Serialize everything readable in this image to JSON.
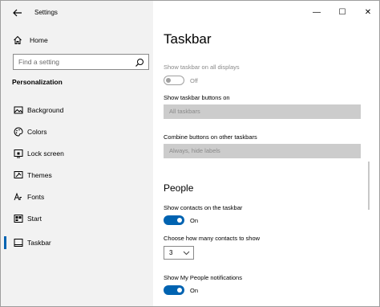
{
  "window": {
    "app_title": "Settings",
    "controls": {
      "minimize": "—",
      "maximize": "☐",
      "close": "✕"
    }
  },
  "sidebar": {
    "home_label": "Home",
    "search_placeholder": "Find a setting",
    "section_label": "Personalization",
    "items": [
      {
        "label": "Background",
        "icon": "picture-icon"
      },
      {
        "label": "Colors",
        "icon": "palette-icon"
      },
      {
        "label": "Lock screen",
        "icon": "lock-screen-icon"
      },
      {
        "label": "Themes",
        "icon": "brush-icon"
      },
      {
        "label": "Fonts",
        "icon": "font-icon"
      },
      {
        "label": "Start",
        "icon": "start-icon"
      },
      {
        "label": "Taskbar",
        "icon": "taskbar-icon",
        "active": true
      }
    ]
  },
  "main": {
    "title": "Taskbar",
    "show_all_displays": {
      "label": "Show taskbar on all displays",
      "state": "Off"
    },
    "show_buttons_on": {
      "label": "Show taskbar buttons on",
      "value": "All taskbars"
    },
    "combine_buttons": {
      "label": "Combine buttons on other taskbars",
      "value": "Always, hide labels"
    },
    "people": {
      "heading": "People",
      "show_contacts": {
        "label": "Show contacts on the taskbar",
        "state": "On"
      },
      "contacts_count": {
        "label": "Choose how many contacts to show",
        "value": "3"
      },
      "notifications": {
        "label": "Show My People notifications",
        "state": "On"
      }
    }
  },
  "colors": {
    "accent": "#0063b1",
    "sidebar_bg": "#f2f2f2",
    "disabled_dropdown": "#cccccc"
  }
}
